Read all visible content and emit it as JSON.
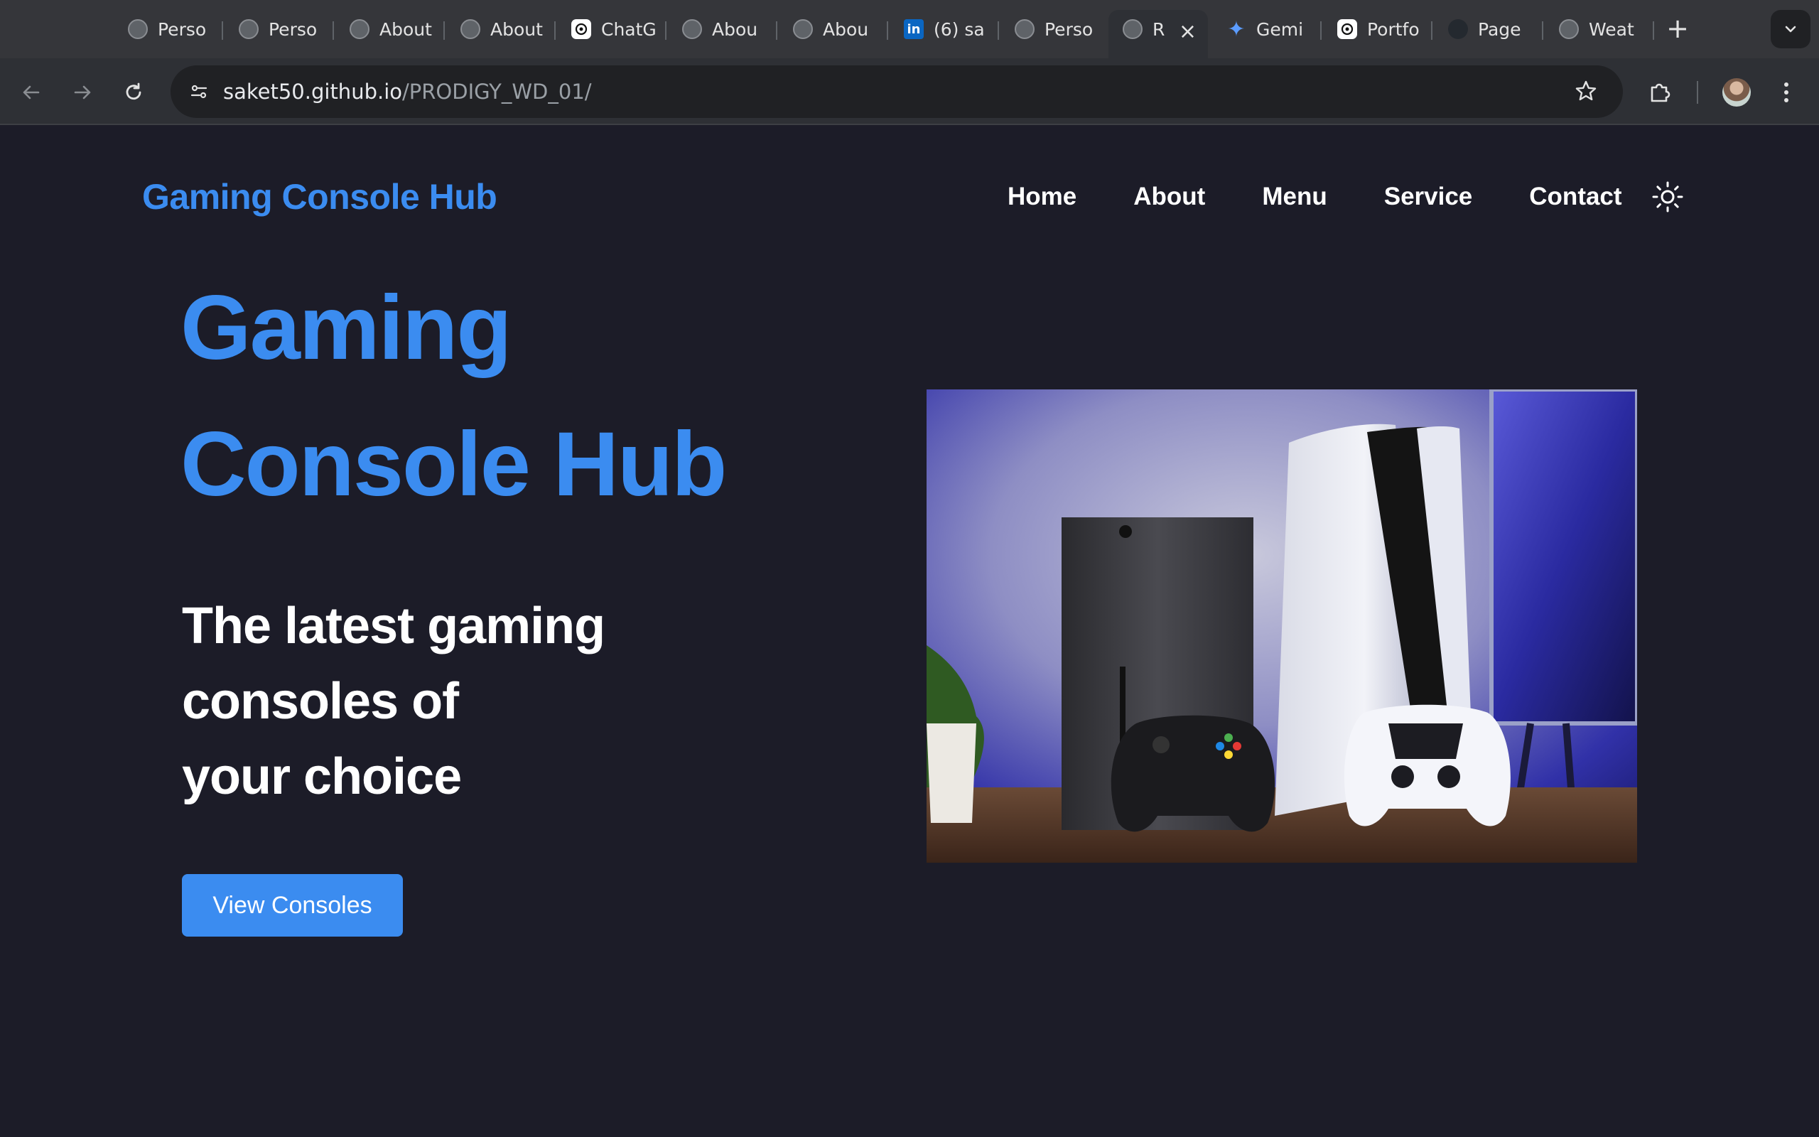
{
  "browser": {
    "tabs": [
      {
        "title": "Perso",
        "icon": "globe-icon"
      },
      {
        "title": "Perso",
        "icon": "globe-icon"
      },
      {
        "title": "About",
        "icon": "globe-icon"
      },
      {
        "title": "About",
        "icon": "globe-icon"
      },
      {
        "title": "ChatG",
        "icon": "chatgpt-icon"
      },
      {
        "title": "Abou",
        "icon": "globe-icon"
      },
      {
        "title": "Abou",
        "icon": "globe-icon"
      },
      {
        "title": "(6) sa",
        "icon": "linkedin-icon"
      },
      {
        "title": "Perso",
        "icon": "globe-icon"
      },
      {
        "title": "R",
        "icon": "globe-icon"
      },
      {
        "title": "Gemi",
        "icon": "gemini-icon"
      },
      {
        "title": "Portfo",
        "icon": "chatgpt-icon"
      },
      {
        "title": "Page",
        "icon": "github-icon"
      },
      {
        "title": "Weat",
        "icon": "globe-icon"
      }
    ],
    "url_host": "saket50.github.io",
    "url_path": "/PRODIGY_WD_01/"
  },
  "site": {
    "brand": "Gaming Console Hub",
    "nav": [
      "Home",
      "About",
      "Menu",
      "Service",
      "Contact"
    ],
    "theme_toggle_icon": "sun-icon"
  },
  "hero": {
    "title_line1": "Gaming",
    "title_line2": "Console Hub",
    "subtitle_line1": "The latest gaming",
    "subtitle_line2": "consoles of",
    "subtitle_line3": "your choice",
    "cta_label": "View Consoles"
  },
  "colors": {
    "accent": "#3b8cf0",
    "page_background": "#1c1c28",
    "text": "#ffffff"
  }
}
